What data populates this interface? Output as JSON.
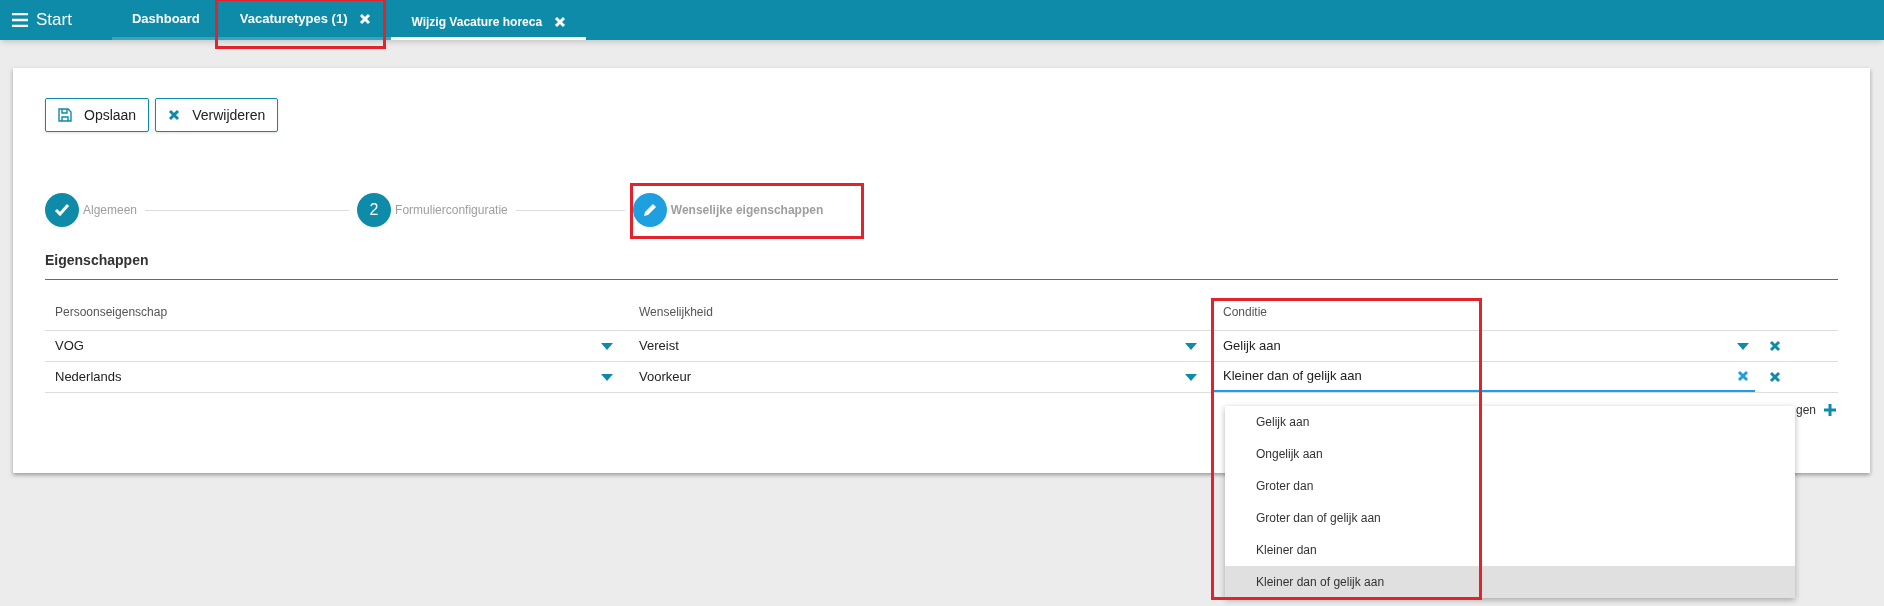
{
  "topbar": {
    "menu_label": "Start",
    "tabs": [
      {
        "label": "Dashboard",
        "closable": false,
        "selected": false
      },
      {
        "label": "Vacaturetypes (1)",
        "closable": true,
        "selected": false
      },
      {
        "label": "Wijzig Vacature horeca",
        "closable": true,
        "selected": true
      }
    ]
  },
  "toolbar": {
    "buttons": [
      {
        "kind": "save",
        "label": "Opslaan"
      },
      {
        "kind": "delete",
        "label": "Verwijderen"
      }
    ]
  },
  "stepper": [
    {
      "kind": "done",
      "label": "Algemeen"
    },
    {
      "kind": "number",
      "label": "Formulierconfiguratie",
      "number": "2"
    },
    {
      "kind": "edit",
      "label": "Wenselijke eigenschappen"
    }
  ],
  "section": {
    "title": "Eigenschappen"
  },
  "table": {
    "columns": [
      "Persoonseigenschap",
      "Wenselijkheid",
      "Conditie"
    ],
    "rows": [
      {
        "cells": [
          "VOG",
          "Vereist",
          "Gelijk aan"
        ],
        "focused": false
      },
      {
        "cells": [
          "Nederlands",
          "Voorkeur",
          "Kleiner dan of gelijk aan"
        ],
        "focused": true
      }
    ]
  },
  "add_label": "gen",
  "dropdown": {
    "options": [
      {
        "label": "Gelijk aan",
        "selected": false
      },
      {
        "label": "Ongelijk aan",
        "selected": false
      },
      {
        "label": "Groter dan",
        "selected": false
      },
      {
        "label": "Groter dan of gelijk aan",
        "selected": false
      },
      {
        "label": "Kleiner dan",
        "selected": false
      },
      {
        "label": "Kleiner dan of gelijk aan",
        "selected": true
      }
    ]
  }
}
